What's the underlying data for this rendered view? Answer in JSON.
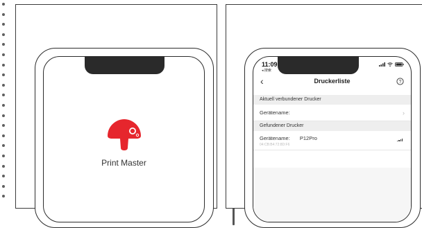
{
  "left_phone": {
    "app_name": "Print Master",
    "logo_icon": "mushroom-icon",
    "logo_color": "#e6262d"
  },
  "right_phone": {
    "status": {
      "time": "11:09",
      "subtitle": "◂ 搜索"
    },
    "nav": {
      "back_icon": "chevron-left-icon",
      "title": "Druckerliste",
      "help_icon": "help-icon"
    },
    "connected_section": {
      "title": "Aktuell verbundener Drucker",
      "device_label": "Gerätename:"
    },
    "found_section": {
      "title": "Gefundener Drucker",
      "device_label": "Gerätename:",
      "device_name": "P12Pro",
      "device_mac": "04:CB:B4:72:8D:F6"
    }
  },
  "colors": {
    "section_bg": "#eeeeee",
    "notch": "#2a2a2a",
    "accent": "#e6262d"
  }
}
